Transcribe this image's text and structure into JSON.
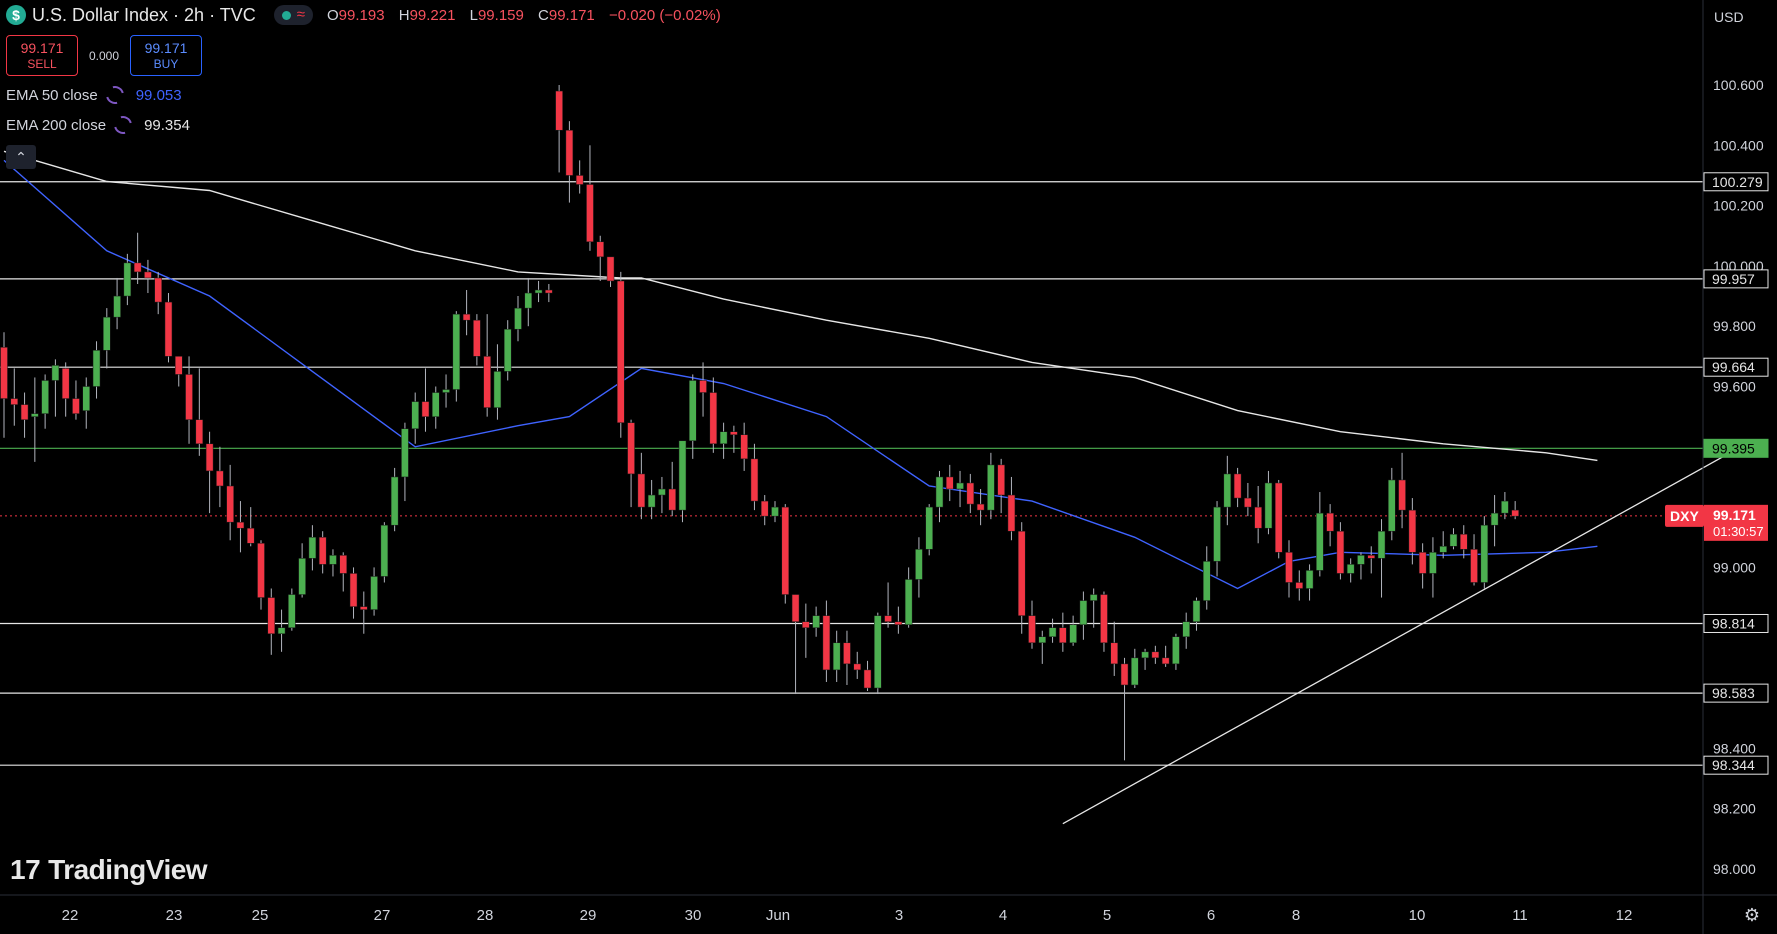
{
  "header": {
    "logo_symbol": "$",
    "title": "U.S. Dollar Index · 2h · TVC",
    "status_icon": "market-open-dot",
    "delay_icon": "≈",
    "ohlc": {
      "o_label": "O",
      "o_value": "99.193",
      "h_label": "H",
      "h_value": "99.221",
      "l_label": "L",
      "l_value": "99.159",
      "c_label": "C",
      "c_value": "99.171",
      "change": "−0.020 (−0.02%)"
    }
  },
  "trade": {
    "sell_price": "99.171",
    "sell_label": "SELL",
    "spread": "0.000",
    "buy_price": "99.171",
    "buy_label": "BUY"
  },
  "indicators": [
    {
      "name": "EMA 50 close",
      "value": "99.053",
      "color": "#3f63ff"
    },
    {
      "name": "EMA 200 close",
      "value": "99.354",
      "color": "#e6e6e6"
    }
  ],
  "collapse_icon": "⌃",
  "brand": {
    "mark": "17",
    "name": "TradingView"
  },
  "price_axis": {
    "currency": "USD",
    "ticks": [
      "100.600",
      "100.400",
      "100.200",
      "100.000",
      "99.800",
      "99.600",
      "99.000",
      "98.400",
      "98.200",
      "98.000"
    ]
  },
  "settings_icon": "⚙",
  "chart_data": {
    "type": "candlestick",
    "symbol": "DXY",
    "interval": "2h",
    "ylim": [
      97.95,
      100.75
    ],
    "x_labels": [
      "22",
      "23",
      "25",
      "27",
      "28",
      "29",
      "30",
      "Jun",
      "3",
      "4",
      "5",
      "6",
      "8",
      "10",
      "11",
      "12"
    ],
    "horizontal_levels": [
      {
        "value": 100.279,
        "label": "100.279",
        "color": "#e6e6e6"
      },
      {
        "value": 99.957,
        "label": "99.957",
        "color": "#e6e6e6"
      },
      {
        "value": 99.664,
        "label": "99.664",
        "color": "#e6e6e6"
      },
      {
        "value": 99.395,
        "label": "99.395",
        "color": "#4caf50"
      },
      {
        "value": 98.814,
        "label": "98.814",
        "color": "#e6e6e6"
      },
      {
        "value": 98.583,
        "label": "98.583",
        "color": "#e6e6e6"
      },
      {
        "value": 98.344,
        "label": "98.344",
        "color": "#e6e6e6"
      }
    ],
    "current_price": {
      "value": 99.171,
      "label": "99.171",
      "countdown": "01:30:57",
      "tag": "DXY",
      "color": "#f23645"
    },
    "trendline": {
      "from": {
        "index": 103,
        "value": 98.15
      },
      "to": {
        "index": 170,
        "value": 99.42
      }
    },
    "ema200": [
      [
        0,
        100.38
      ],
      [
        10,
        100.28
      ],
      [
        20,
        100.25
      ],
      [
        30,
        100.15
      ],
      [
        40,
        100.05
      ],
      [
        50,
        99.98
      ],
      [
        60,
        99.96
      ],
      [
        62,
        99.96
      ],
      [
        70,
        99.89
      ],
      [
        80,
        99.82
      ],
      [
        90,
        99.76
      ],
      [
        100,
        99.68
      ],
      [
        110,
        99.63
      ],
      [
        120,
        99.52
      ],
      [
        130,
        99.45
      ],
      [
        140,
        99.41
      ],
      [
        150,
        99.38
      ],
      [
        155,
        99.355
      ]
    ],
    "ema50": [
      [
        0,
        100.35
      ],
      [
        10,
        100.05
      ],
      [
        20,
        99.9
      ],
      [
        30,
        99.65
      ],
      [
        40,
        99.4
      ],
      [
        50,
        99.47
      ],
      [
        55,
        99.5
      ],
      [
        62,
        99.66
      ],
      [
        70,
        99.61
      ],
      [
        80,
        99.5
      ],
      [
        90,
        99.27
      ],
      [
        100,
        99.22
      ],
      [
        110,
        99.1
      ],
      [
        120,
        98.93
      ],
      [
        125,
        99.02
      ],
      [
        130,
        99.05
      ],
      [
        140,
        99.04
      ],
      [
        150,
        99.05
      ],
      [
        155,
        99.07
      ]
    ],
    "candles": [
      [
        99.73,
        99.78,
        99.43,
        99.56
      ],
      [
        99.56,
        99.66,
        99.47,
        99.54
      ],
      [
        99.54,
        99.58,
        99.43,
        99.49
      ],
      [
        99.5,
        99.63,
        99.35,
        99.51
      ],
      [
        99.51,
        99.64,
        99.46,
        99.62
      ],
      [
        99.62,
        99.69,
        99.5,
        99.67
      ],
      [
        99.66,
        99.68,
        99.5,
        99.56
      ],
      [
        99.56,
        99.62,
        99.49,
        99.51
      ],
      [
        99.52,
        99.63,
        99.46,
        99.6
      ],
      [
        99.6,
        99.75,
        99.56,
        99.72
      ],
      [
        99.72,
        99.86,
        99.66,
        99.83
      ],
      [
        99.83,
        99.96,
        99.79,
        99.9
      ],
      [
        99.9,
        100.04,
        99.87,
        100.01
      ],
      [
        100.01,
        100.11,
        99.94,
        99.98
      ],
      [
        99.98,
        100.02,
        99.91,
        99.96
      ],
      [
        99.96,
        99.98,
        99.84,
        99.88
      ],
      [
        99.88,
        99.91,
        99.68,
        99.7
      ],
      [
        99.7,
        99.7,
        99.6,
        99.64
      ],
      [
        99.64,
        99.7,
        99.41,
        99.49
      ],
      [
        99.49,
        99.66,
        99.37,
        99.41
      ],
      [
        99.41,
        99.45,
        99.18,
        99.32
      ],
      [
        99.32,
        99.4,
        99.2,
        99.27
      ],
      [
        99.27,
        99.34,
        99.09,
        99.15
      ],
      [
        99.15,
        99.22,
        99.05,
        99.13
      ],
      [
        99.13,
        99.2,
        99.07,
        99.08
      ],
      [
        99.08,
        99.09,
        98.86,
        98.9
      ],
      [
        98.9,
        98.93,
        98.71,
        98.78
      ],
      [
        98.78,
        98.86,
        98.72,
        98.8
      ],
      [
        98.8,
        98.93,
        98.79,
        98.91
      ],
      [
        98.91,
        99.08,
        98.9,
        99.03
      ],
      [
        99.03,
        99.14,
        98.99,
        99.1
      ],
      [
        99.1,
        99.12,
        98.98,
        99.01
      ],
      [
        99.01,
        99.06,
        98.97,
        99.04
      ],
      [
        99.04,
        99.05,
        98.92,
        98.98
      ],
      [
        98.98,
        99.0,
        98.83,
        98.87
      ],
      [
        98.87,
        98.92,
        98.78,
        98.86
      ],
      [
        98.86,
        99.0,
        98.84,
        98.97
      ],
      [
        98.97,
        99.15,
        98.95,
        99.14
      ],
      [
        99.14,
        99.33,
        99.12,
        99.3
      ],
      [
        99.3,
        99.48,
        99.22,
        99.46
      ],
      [
        99.46,
        99.58,
        99.41,
        99.55
      ],
      [
        99.55,
        99.66,
        99.45,
        99.5
      ],
      [
        99.5,
        99.6,
        99.46,
        99.58
      ],
      [
        99.58,
        99.64,
        99.53,
        99.59
      ],
      [
        99.59,
        99.85,
        99.55,
        99.84
      ],
      [
        99.84,
        99.92,
        99.77,
        99.82
      ],
      [
        99.82,
        99.84,
        99.67,
        99.7
      ],
      [
        99.7,
        99.84,
        99.5,
        99.53
      ],
      [
        99.53,
        99.74,
        99.49,
        99.65
      ],
      [
        99.65,
        99.82,
        99.62,
        99.79
      ],
      [
        99.79,
        99.9,
        99.75,
        99.86
      ],
      [
        99.86,
        99.96,
        99.8,
        99.91
      ],
      [
        99.91,
        99.95,
        99.88,
        99.92
      ],
      [
        99.92,
        99.94,
        99.88,
        99.91
      ],
      [
        100.58,
        100.6,
        100.31,
        100.45
      ],
      [
        100.45,
        100.48,
        100.21,
        100.3
      ],
      [
        100.3,
        100.35,
        100.24,
        100.27
      ],
      [
        100.27,
        100.4,
        100.05,
        100.08
      ],
      [
        100.08,
        100.1,
        99.95,
        100.03
      ],
      [
        100.03,
        100.02,
        99.93,
        99.95
      ],
      [
        99.95,
        99.98,
        99.43,
        99.48
      ],
      [
        99.48,
        99.49,
        99.2,
        99.31
      ],
      [
        99.31,
        99.38,
        99.16,
        99.2
      ],
      [
        99.2,
        99.29,
        99.16,
        99.24
      ],
      [
        99.24,
        99.3,
        99.18,
        99.26
      ],
      [
        99.26,
        99.35,
        99.17,
        99.19
      ],
      [
        99.19,
        99.42,
        99.15,
        99.42
      ],
      [
        99.42,
        99.64,
        99.36,
        99.62
      ],
      [
        99.62,
        99.68,
        99.5,
        99.58
      ],
      [
        99.58,
        99.63,
        99.38,
        99.41
      ],
      [
        99.41,
        99.48,
        99.36,
        99.45
      ],
      [
        99.45,
        99.47,
        99.38,
        99.44
      ],
      [
        99.44,
        99.48,
        99.32,
        99.36
      ],
      [
        99.36,
        99.41,
        99.19,
        99.22
      ],
      [
        99.22,
        99.24,
        99.14,
        99.17
      ],
      [
        99.17,
        99.22,
        99.15,
        99.2
      ],
      [
        99.2,
        99.21,
        98.88,
        98.91
      ],
      [
        98.91,
        98.91,
        98.58,
        98.82
      ],
      [
        98.82,
        98.88,
        98.7,
        98.8
      ],
      [
        98.8,
        98.87,
        98.77,
        98.84
      ],
      [
        98.84,
        98.89,
        98.62,
        98.66
      ],
      [
        98.66,
        98.79,
        98.62,
        98.75
      ],
      [
        98.75,
        98.79,
        98.61,
        98.68
      ],
      [
        98.68,
        98.72,
        98.63,
        98.66
      ],
      [
        98.66,
        98.69,
        98.59,
        98.6
      ],
      [
        98.6,
        98.85,
        98.58,
        98.84
      ],
      [
        98.84,
        98.95,
        98.8,
        98.82
      ],
      [
        98.82,
        98.87,
        98.78,
        98.81
      ],
      [
        98.81,
        99.0,
        98.8,
        98.96
      ],
      [
        98.96,
        99.1,
        98.9,
        99.06
      ],
      [
        99.06,
        99.21,
        99.04,
        99.2
      ],
      [
        99.2,
        99.32,
        99.15,
        99.3
      ],
      [
        99.3,
        99.34,
        99.22,
        99.26
      ],
      [
        99.26,
        99.32,
        99.2,
        99.28
      ],
      [
        99.28,
        99.31,
        99.18,
        99.21
      ],
      [
        99.21,
        99.26,
        99.14,
        99.19
      ],
      [
        99.19,
        99.38,
        99.16,
        99.34
      ],
      [
        99.34,
        99.36,
        99.18,
        99.24
      ],
      [
        99.24,
        99.3,
        99.09,
        99.12
      ],
      [
        99.12,
        99.15,
        98.78,
        98.84
      ],
      [
        98.84,
        98.89,
        98.73,
        98.75
      ],
      [
        98.75,
        98.79,
        98.68,
        98.77
      ],
      [
        98.77,
        98.83,
        98.75,
        98.8
      ],
      [
        98.8,
        98.85,
        98.72,
        98.75
      ],
      [
        98.75,
        98.84,
        98.74,
        98.81
      ],
      [
        98.81,
        98.92,
        98.76,
        98.89
      ],
      [
        98.89,
        98.93,
        98.8,
        98.91
      ],
      [
        98.91,
        98.92,
        98.72,
        98.75
      ],
      [
        98.75,
        98.82,
        98.64,
        98.68
      ],
      [
        98.68,
        98.7,
        98.36,
        98.61
      ],
      [
        98.61,
        98.73,
        98.6,
        98.7
      ],
      [
        98.7,
        98.73,
        98.66,
        98.72
      ],
      [
        98.72,
        98.74,
        98.68,
        98.7
      ],
      [
        98.7,
        98.74,
        98.67,
        98.68
      ],
      [
        98.68,
        98.78,
        98.66,
        98.77
      ],
      [
        98.77,
        98.85,
        98.73,
        98.82
      ],
      [
        98.82,
        98.9,
        98.79,
        98.89
      ],
      [
        98.89,
        99.07,
        98.86,
        99.02
      ],
      [
        99.02,
        99.22,
        98.97,
        99.2
      ],
      [
        99.2,
        99.37,
        99.14,
        99.31
      ],
      [
        99.31,
        99.33,
        99.2,
        99.23
      ],
      [
        99.23,
        99.28,
        99.17,
        99.2
      ],
      [
        99.2,
        99.27,
        99.08,
        99.13
      ],
      [
        99.13,
        99.32,
        99.11,
        99.28
      ],
      [
        99.28,
        99.29,
        99.03,
        99.05
      ],
      [
        99.05,
        99.09,
        98.9,
        98.95
      ],
      [
        98.95,
        98.99,
        98.89,
        98.93
      ],
      [
        98.93,
        99.01,
        98.89,
        98.99
      ],
      [
        98.99,
        99.25,
        98.97,
        99.18
      ],
      [
        99.18,
        99.21,
        99.07,
        99.12
      ],
      [
        99.12,
        99.15,
        98.96,
        98.98
      ],
      [
        98.98,
        99.03,
        98.95,
        99.01
      ],
      [
        99.01,
        99.05,
        98.96,
        99.04
      ],
      [
        99.04,
        99.07,
        98.98,
        99.03
      ],
      [
        99.03,
        99.16,
        98.9,
        99.12
      ],
      [
        99.12,
        99.33,
        99.09,
        99.29
      ],
      [
        99.29,
        99.38,
        99.13,
        99.19
      ],
      [
        99.19,
        99.23,
        99.01,
        99.05
      ],
      [
        99.05,
        99.08,
        98.93,
        98.98
      ],
      [
        98.98,
        99.1,
        98.9,
        99.05
      ],
      [
        99.05,
        99.12,
        99.03,
        99.07
      ],
      [
        99.07,
        99.13,
        99.06,
        99.11
      ],
      [
        99.11,
        99.14,
        99.03,
        99.06
      ],
      [
        99.06,
        99.11,
        98.94,
        98.95
      ],
      [
        98.95,
        99.17,
        98.93,
        99.14
      ],
      [
        99.14,
        99.24,
        99.07,
        99.18
      ],
      [
        99.18,
        99.25,
        99.16,
        99.22
      ],
      [
        99.19,
        99.22,
        99.16,
        99.17
      ]
    ]
  }
}
